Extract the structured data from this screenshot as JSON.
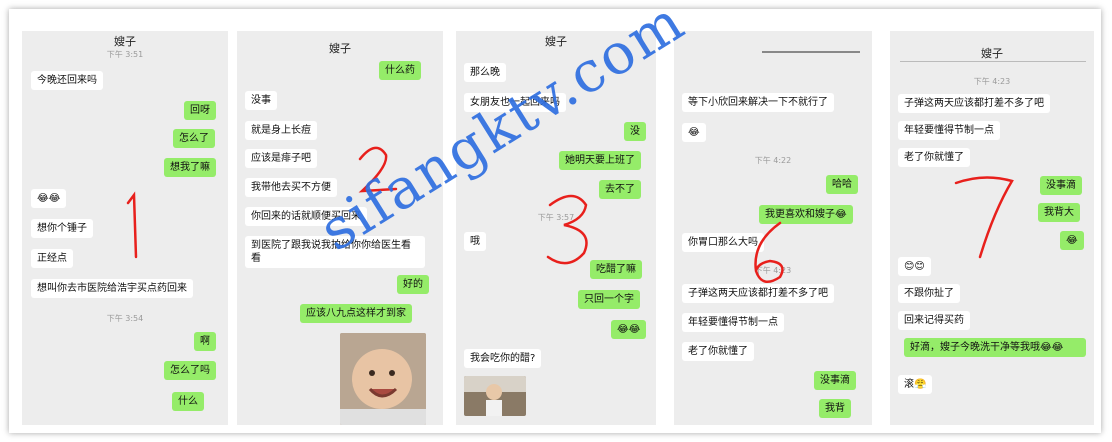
{
  "panels": [
    {
      "title": "嫂子",
      "items": [
        {
          "t": "ts",
          "v": "下午 3:51"
        },
        {
          "t": "in",
          "v": "今晚还回来吗"
        },
        {
          "t": "out",
          "v": "回呀"
        },
        {
          "t": "out",
          "v": "怎么了"
        },
        {
          "t": "out",
          "v": "想我了嘛"
        },
        {
          "t": "in",
          "v": "😂😂"
        },
        {
          "t": "in",
          "v": "想你个锤子"
        },
        {
          "t": "in",
          "v": "正经点"
        },
        {
          "t": "in",
          "v": "想叫你去市医院给浩宇买点药回来"
        },
        {
          "t": "ts",
          "v": "下午 3:54"
        },
        {
          "t": "out",
          "v": "啊"
        },
        {
          "t": "out",
          "v": "怎么了吗"
        },
        {
          "t": "out",
          "v": "什么"
        }
      ],
      "mark": "1"
    },
    {
      "title": "嫂子",
      "items": [
        {
          "t": "out",
          "v": "什么药"
        },
        {
          "t": "in",
          "v": "没事"
        },
        {
          "t": "in",
          "v": "就是身上长痘"
        },
        {
          "t": "in",
          "v": "应该是痱子吧"
        },
        {
          "t": "in",
          "v": "我带他去买不方便"
        },
        {
          "t": "in",
          "v": "你回来的话就顺便买回来"
        },
        {
          "t": "in",
          "v": "到医院了跟我说我拍给你你给医生看看"
        },
        {
          "t": "out",
          "v": "好的"
        },
        {
          "t": "out",
          "v": "应该八九点这样才到家"
        },
        {
          "t": "photo",
          "v": "baby-photo"
        }
      ],
      "mark": "2"
    },
    {
      "title": "嫂子",
      "items": [
        {
          "t": "in",
          "v": "那么晚"
        },
        {
          "t": "in",
          "v": "女朋友也一起回来吗"
        },
        {
          "t": "out",
          "v": "没"
        },
        {
          "t": "out",
          "v": "她明天要上班了"
        },
        {
          "t": "out",
          "v": "去不了"
        },
        {
          "t": "ts",
          "v": "下午 3:57"
        },
        {
          "t": "in",
          "v": "哦"
        },
        {
          "t": "out",
          "v": "吃醋了嘛"
        },
        {
          "t": "out",
          "v": "只回一个字"
        },
        {
          "t": "out",
          "v": "😂😂"
        },
        {
          "t": "in",
          "v": "我会吃你的醋?"
        },
        {
          "t": "photo",
          "v": "child-photo"
        }
      ],
      "mark": "3"
    },
    {
      "title": "",
      "items": [
        {
          "t": "in",
          "v": "等下小欣回来解决一下不就行了"
        },
        {
          "t": "in",
          "v": "😂"
        },
        {
          "t": "ts",
          "v": "下午 4:22"
        },
        {
          "t": "out",
          "v": "哈哈"
        },
        {
          "t": "out",
          "v": "我更喜欢和嫂子😂"
        },
        {
          "t": "in",
          "v": "你胃口那么大吗"
        },
        {
          "t": "ts",
          "v": "下午 4:23"
        },
        {
          "t": "in",
          "v": "子弹这两天应该都打差不多了吧"
        },
        {
          "t": "in",
          "v": "年轻要懂得节制一点"
        },
        {
          "t": "in",
          "v": "老了你就懂了"
        },
        {
          "t": "out",
          "v": "没事滴"
        },
        {
          "t": "out",
          "v": "我背"
        }
      ],
      "mark": "6"
    },
    {
      "title": "嫂子",
      "items": [
        {
          "t": "ts",
          "v": "下午 4:23"
        },
        {
          "t": "in",
          "v": "子弹这两天应该都打差不多了吧"
        },
        {
          "t": "in",
          "v": "年轻要懂得节制一点"
        },
        {
          "t": "in",
          "v": "老了你就懂了"
        },
        {
          "t": "out",
          "v": "没事滴"
        },
        {
          "t": "out",
          "v": "我背大"
        },
        {
          "t": "out",
          "v": "😂"
        },
        {
          "t": "in",
          "v": "😊😊"
        },
        {
          "t": "in",
          "v": "不跟你扯了"
        },
        {
          "t": "in",
          "v": "回来记得买药"
        },
        {
          "t": "out",
          "v": "好滴，嫂子今晚洗干净等我哦😂😂"
        },
        {
          "t": "in",
          "v": "滚😤"
        }
      ],
      "mark": "7"
    }
  ],
  "watermark": "sifangktv.com",
  "colors": {
    "chat_bg": "#ededed",
    "bubble_in": "#ffffff",
    "bubble_out": "#95ec69",
    "scribble": "#e8201c",
    "watermark": "#2f6fe0"
  }
}
